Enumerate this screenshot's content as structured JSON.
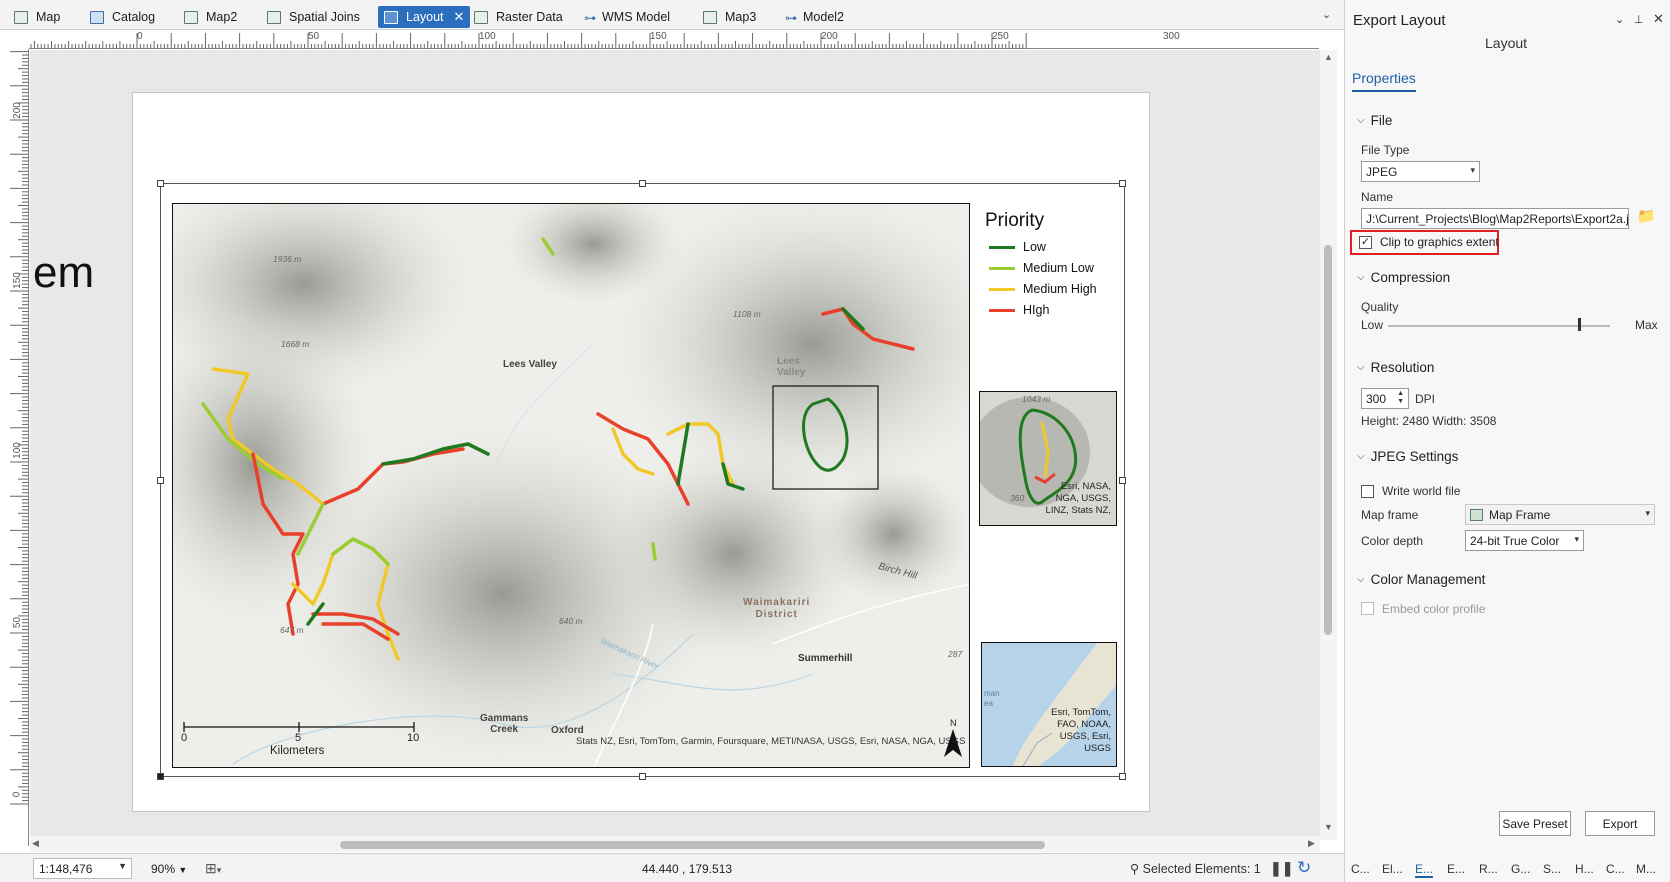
{
  "tabs": [
    {
      "label": "Map",
      "icon": "map-icon"
    },
    {
      "label": "Catalog",
      "icon": "catalog-icon"
    },
    {
      "label": "Map2",
      "icon": "map-icon"
    },
    {
      "label": "Spatial Joins",
      "icon": "map-icon"
    },
    {
      "label": "Layout",
      "icon": "layout-icon",
      "active": true
    },
    {
      "label": "Raster Data",
      "icon": "map-icon"
    },
    {
      "label": "WMS Model",
      "icon": "model-icon"
    },
    {
      "label": "Map3",
      "icon": "map-icon"
    },
    {
      "label": "Model2",
      "icon": "model-icon"
    }
  ],
  "ruler": {
    "h_labels": [
      "0",
      "50",
      "100",
      "150",
      "200",
      "250",
      "300"
    ],
    "v_labels": [
      "200",
      "150",
      "100",
      "50",
      "0"
    ]
  },
  "canvas": {
    "partial_text": "em"
  },
  "map": {
    "place_labels": [
      "Lees Valley",
      "Lees\nValley",
      "Waimakariri\nDistrict",
      "Summerhill",
      "Birch Hill",
      "Gammans\nCreek",
      "Oxford",
      "Waimakariri River"
    ],
    "elevations": [
      "1936 m",
      "1668 m",
      "1108 m",
      "640 m",
      "647 m",
      "287"
    ],
    "legend": {
      "title": "Priority",
      "items": [
        {
          "label": "Low",
          "color": "#1f7a1f"
        },
        {
          "label": "Medium Low",
          "color": "#9acd32"
        },
        {
          "label": "Medium High",
          "color": "#f0c929"
        },
        {
          "label": "HIgh",
          "color": "#e8402a"
        }
      ]
    },
    "inset1": {
      "elev_top": "1043 m",
      "elev_left": "360",
      "credit": "Esri, NASA,\nNGA, USGS,\nLINZ, Stats NZ,"
    },
    "inset2": {
      "label": "man\nea",
      "credit": "Esri, TomTom,\nFAO, NOAA,\nUSGS, Esri,\nUSGS"
    },
    "scalebar": {
      "ticks": [
        "0",
        "5",
        "10"
      ],
      "unit": "Kilometers"
    },
    "credits": "Stats NZ, Esri, TomTom, Garmin, Foursquare, METI/NASA, USGS, Esri, NASA, NGA, USGS",
    "north": "N"
  },
  "status": {
    "scale": "1:148,476",
    "zoom": "90%",
    "coords": "44.440 , 179.513",
    "selected": "Selected Elements: 1"
  },
  "panel": {
    "title": "Export Layout",
    "subtitle": "Layout",
    "tab": "Properties",
    "file": {
      "section": "File",
      "type_label": "File Type",
      "type_value": "JPEG",
      "name_label": "Name",
      "name_value": "J:\\Current_Projects\\Blog\\Map2Reports\\Export2a.jpg",
      "clip_label": "Clip to graphics extent",
      "clip_checked": true
    },
    "compression": {
      "section": "Compression",
      "quality_label": "Quality",
      "low": "Low",
      "max": "Max",
      "quality_value": 0.88
    },
    "resolution": {
      "section": "Resolution",
      "dpi_value": "300",
      "dpi_unit": "DPI",
      "size_text": "Height: 2480 Width: 3508"
    },
    "jpeg": {
      "section": "JPEG Settings",
      "world_file_label": "Write world file",
      "world_file_checked": false,
      "map_frame_label": "Map frame",
      "map_frame_value": "Map Frame",
      "color_depth_label": "Color depth",
      "color_depth_value": "24-bit True Color"
    },
    "color_mgmt": {
      "section": "Color Management",
      "embed_label": "Embed color profile"
    },
    "buttons": {
      "save_preset": "Save Preset",
      "export": "Export"
    },
    "bottom_tabs": [
      "C...",
      "El...",
      "E...",
      "E...",
      "R...",
      "G...",
      "S...",
      "H...",
      "C...",
      "M..."
    ]
  },
  "colors": {
    "accent": "#2a6ebd",
    "highlight": "#e02020"
  }
}
